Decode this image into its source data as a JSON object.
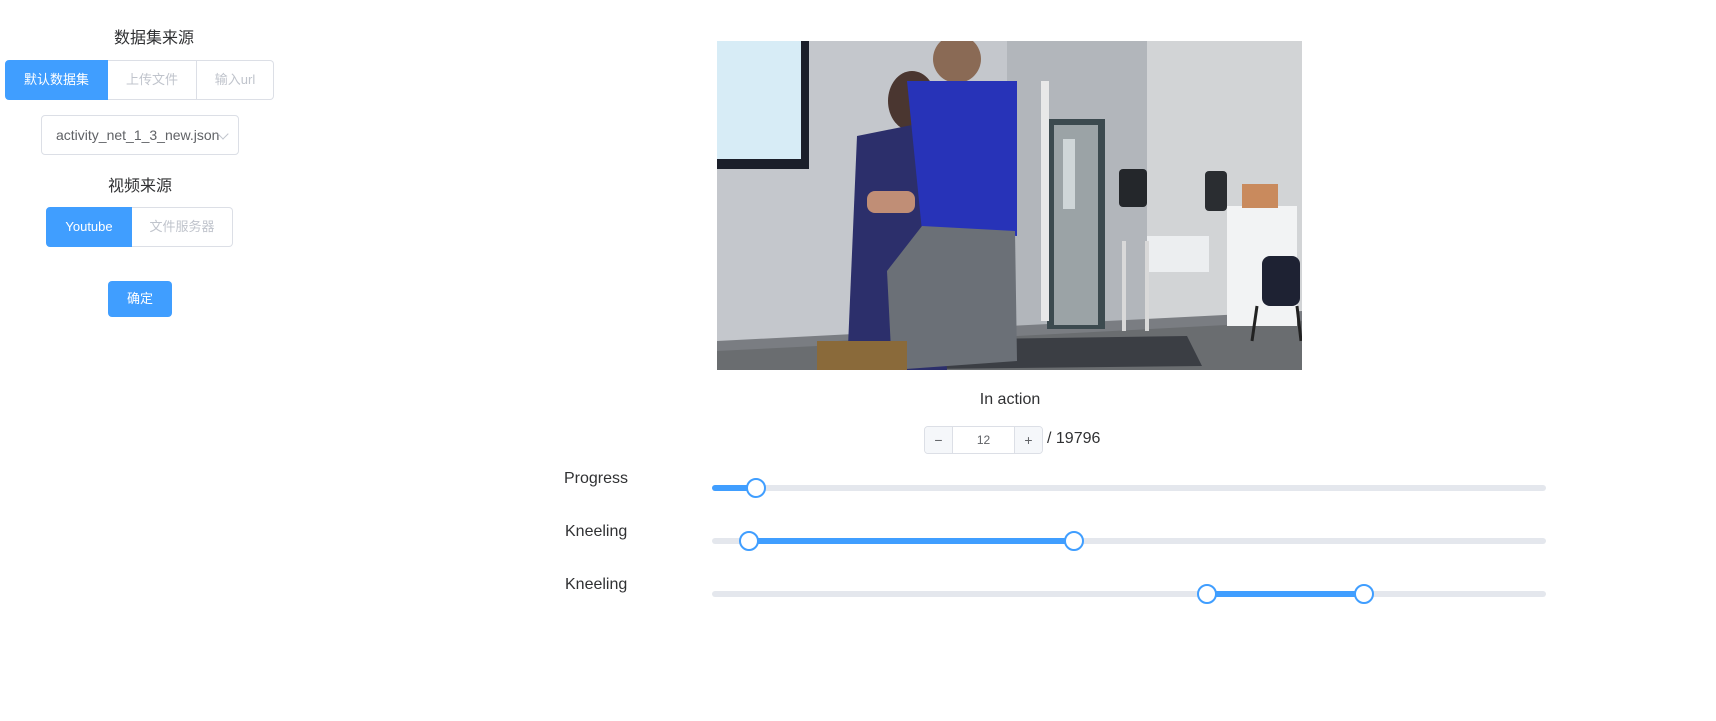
{
  "sidebar": {
    "dataset_source_title": "数据集来源",
    "dataset_tabs": [
      "默认数据集",
      "上传文件",
      "输入url"
    ],
    "dataset_select_value": "activity_net_1_3_new.json",
    "video_source_title": "视频来源",
    "video_tabs": [
      "Youtube",
      "文件服务器"
    ],
    "confirm_label": "确定"
  },
  "player": {
    "status": "In action",
    "frame": {
      "minus": "−",
      "plus": "+",
      "current": "12",
      "total": "/ 19796"
    }
  },
  "sliders": [
    {
      "label": "Progress",
      "fraction": 0.053
    },
    {
      "label": "Kneeling",
      "range": [
        0.044,
        0.434
      ]
    },
    {
      "label": "Kneeling",
      "range": [
        0.594,
        0.782
      ]
    }
  ],
  "colors": {
    "accent": "#409eff",
    "track": "#e4e7ed"
  }
}
